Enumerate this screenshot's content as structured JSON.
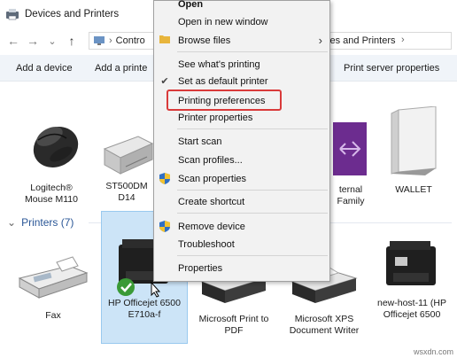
{
  "window": {
    "title": "Devices and Printers"
  },
  "nav": {
    "back": "←",
    "forward": "→",
    "down": "⌄",
    "up": "↑"
  },
  "address": {
    "left_part": "Contro",
    "right_part": "ces and Printers",
    "chevron": "›"
  },
  "commands": {
    "add_device": "Add a device",
    "add_printer": "Add a printe",
    "print_server": "Print server properties"
  },
  "devices": [
    {
      "label_line1": "Logitech®",
      "label_line2": "Mouse M110",
      "icon": "mouse-icon"
    },
    {
      "label_line1": "ST500DM",
      "label_line2": "D14",
      "icon": "drive-icon"
    },
    {
      "label_line1": "ternal",
      "label_line2": "Family",
      "icon": "external-drive-icon"
    },
    {
      "label_line1": "WALLET",
      "label_line2": "",
      "icon": "wallet-drive-icon"
    }
  ],
  "printers_section": {
    "title": "Printers (7)",
    "chevron": "⌄"
  },
  "printers": [
    {
      "label_line1": "Fax",
      "label_line2": "",
      "icon": "fax-icon"
    },
    {
      "label_line1": "HP Officejet 6500",
      "label_line2": "E710a-f",
      "icon": "printer-icon",
      "default": true,
      "selected": true
    },
    {
      "label_line1": "Microsoft Print to",
      "label_line2": "PDF",
      "icon": "printer-icon"
    },
    {
      "label_line1": "Microsoft XPS",
      "label_line2": "Document Writer",
      "icon": "printer-icon"
    },
    {
      "label_line1": "new-host-11 (HP",
      "label_line2": "Officejet 6500",
      "icon": "printer-icon"
    }
  ],
  "context_menu": {
    "open": "Open",
    "open_new_window": "Open in new window",
    "browse_files": "Browse files",
    "see_whats_printing": "See what's printing",
    "set_default": "Set as default printer",
    "printing_preferences": "Printing preferences",
    "printer_properties": "Printer properties",
    "start_scan": "Start scan",
    "scan_profiles": "Scan profiles...",
    "scan_properties": "Scan properties",
    "create_shortcut": "Create shortcut",
    "remove_device": "Remove device",
    "troubleshoot": "Troubleshoot",
    "properties": "Properties",
    "submenu_arrow": "›",
    "check_mark": "✔"
  },
  "watermark": "wsxdn.com",
  "colors": {
    "highlight_border": "#d93a3a",
    "selection": "#cce4f7",
    "section_blue": "#2b5797"
  }
}
